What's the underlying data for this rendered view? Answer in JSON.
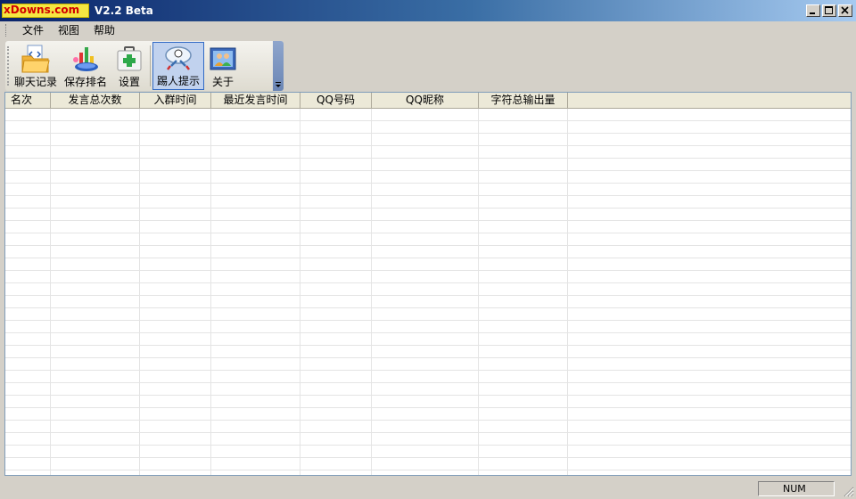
{
  "window": {
    "logo_text": "xDowns.com",
    "title": "V2.2 Beta",
    "controls": {
      "minimize_icon": "minimize-icon",
      "maximize_icon": "maximize-icon",
      "close_icon": "close-icon"
    }
  },
  "menu": {
    "items": [
      "文件",
      "视图",
      "帮助"
    ]
  },
  "toolbar": {
    "buttons": [
      {
        "label": "聊天记录",
        "icon": "chat-log-folder-icon"
      },
      {
        "label": "保存排名",
        "icon": "save-ranking-icon"
      },
      {
        "label": "设置",
        "icon": "settings-medkit-icon"
      },
      {
        "label": "踢人提示",
        "icon": "kick-alert-icon",
        "active": true
      },
      {
        "label": "关于",
        "icon": "about-people-icon"
      }
    ]
  },
  "table": {
    "columns": [
      "名次",
      "发言总次数",
      "入群时间",
      "最近发言时间",
      "QQ号码",
      "QQ昵称",
      "字符总输出量"
    ],
    "rows": []
  },
  "status": {
    "num": "NUM"
  }
}
